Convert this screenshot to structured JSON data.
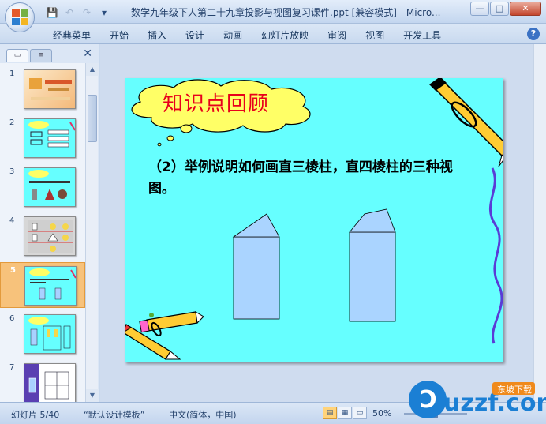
{
  "window": {
    "title": "数学九年级下人第二十九章投影与视图复习课件.ppt [兼容模式] - Micro...",
    "controls": [
      "—",
      "□",
      "✕"
    ]
  },
  "quick_access": {
    "save": "💾",
    "undo": "↶",
    "redo": "↷",
    "more": "▾"
  },
  "ribbon": {
    "tabs": [
      "经典菜单",
      "开始",
      "插入",
      "设计",
      "动画",
      "幻灯片放映",
      "审阅",
      "视图",
      "开发工具"
    ],
    "help": "?"
  },
  "left_pane": {
    "tab_slides": "▭",
    "tab_outline": "≡",
    "close": "✕",
    "thumbnails": [
      {
        "num": "1"
      },
      {
        "num": "2"
      },
      {
        "num": "3"
      },
      {
        "num": "4"
      },
      {
        "num": "5",
        "selected": true
      },
      {
        "num": "6"
      },
      {
        "num": "7"
      }
    ]
  },
  "slide": {
    "title": "知识点回顾",
    "body": "（2）举例说明如何画直三棱柱，直四棱柱的三种视图。"
  },
  "statusbar": {
    "slide_counter": "幻灯片 5/40",
    "template": "“默认设计模板”",
    "language": "中文(简体，中国)",
    "zoom": "50%",
    "zoom_fraction": 0.5
  },
  "watermark": {
    "brand": "uzzf.com",
    "cn_text": "东坡下载"
  },
  "colors": {
    "slide_background": "#66ffff",
    "title_red": "#e8001c",
    "selected_thumb": "#f7c27b"
  }
}
